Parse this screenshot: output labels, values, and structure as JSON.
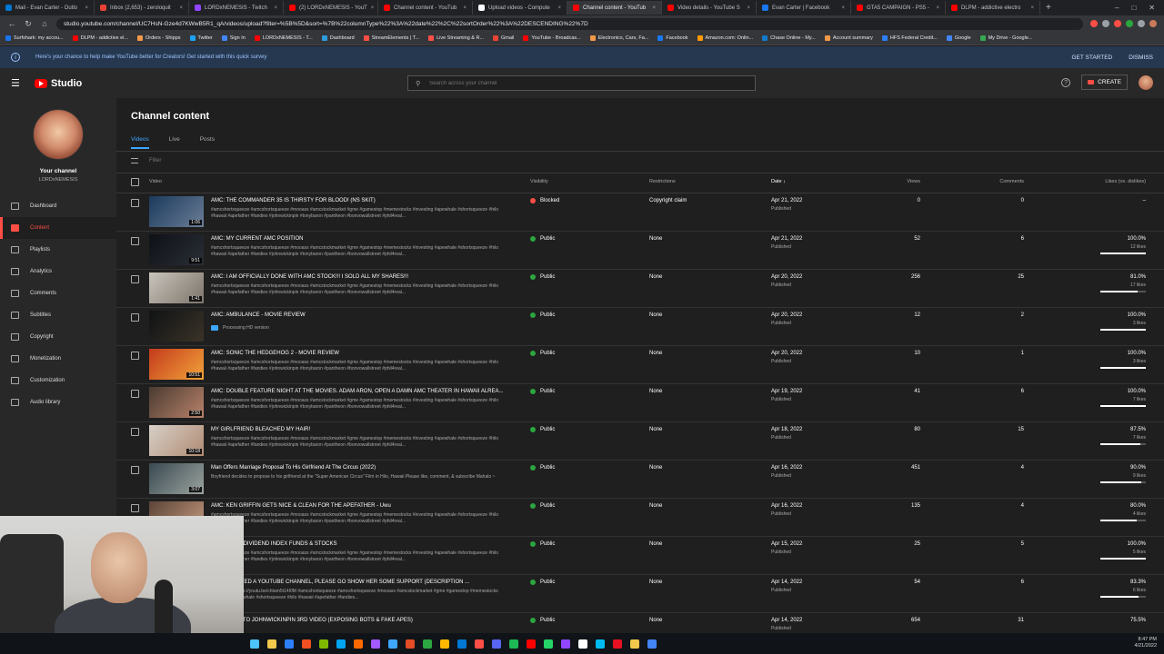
{
  "browser": {
    "tabs": [
      {
        "title": "Mail - Evan Carter - Outlo",
        "color": "#0078d4",
        "active": false
      },
      {
        "title": "Inbox (2,653) - zeroloquit",
        "color": "#ea4335",
        "active": false
      },
      {
        "title": "LORDxNEMESIS - Twitch",
        "color": "#9146ff",
        "active": false
      },
      {
        "title": "(2) LORDxNEMESIS - YouT",
        "color": "#ff0000",
        "active": false
      },
      {
        "title": "Channel content - YouTub",
        "color": "#ff0000",
        "active": false
      },
      {
        "title": "Upload videos - Compute",
        "color": "#ffffff",
        "active": false
      },
      {
        "title": "Channel content - YouTub",
        "color": "#ff0000",
        "active": true
      },
      {
        "title": "Video details - YouTube S",
        "color": "#ff0000",
        "active": false
      },
      {
        "title": "Evan Carter | Facebook",
        "color": "#1877f2",
        "active": false
      },
      {
        "title": "GTA5 CAMPAIGN - PS5 -",
        "color": "#ff0000",
        "active": false
      },
      {
        "title": "DLPM - addictive electro",
        "color": "#ff0000",
        "active": false
      }
    ],
    "new_tab": "+",
    "url": "studio.youtube.com/channel/UC7HsN-Gze4d7KWwB5R1_qA/videos/upload?filter=%5B%5D&sort=%7B%22columnType%22%3A%22date%22%2C%22sortOrder%22%3A%22DESCENDING%22%7D",
    "bookmarks": [
      "Surfshark: my accou...",
      "DLPM - addictive el...",
      "Orders - Shipps",
      "Twitter",
      "Sign In",
      "LORDxNEMESIS - T...",
      "Dashboard",
      "StreamElements | T...",
      "Live Streaming & R...",
      "Gmail",
      "YouTube - Broadcas...",
      "Electronics, Cars, Fa...",
      "Facebook",
      "Amazon.com: Onlin...",
      "Chase Online - My...",
      "Account summary",
      "HFS Federal Credit...",
      "Google",
      "My Drive - Google..."
    ]
  },
  "banner": {
    "text": "Here's your chance to help make YouTube better for Creators! Get started with this quick survey",
    "get_started": "GET STARTED",
    "dismiss": "DISMISS"
  },
  "header": {
    "studio": "Studio",
    "search_placeholder": "Search across your channel",
    "create": "CREATE"
  },
  "sidebar": {
    "your_channel": "Your channel",
    "channel_name": "LORDxNEMESIS",
    "items": [
      {
        "label": "Dashboard",
        "icon": "dashboard-icon",
        "active": false
      },
      {
        "label": "Content",
        "icon": "content-icon",
        "active": true
      },
      {
        "label": "Playlists",
        "icon": "playlists-icon",
        "active": false
      },
      {
        "label": "Analytics",
        "icon": "analytics-icon",
        "active": false
      },
      {
        "label": "Comments",
        "icon": "comments-icon",
        "active": false
      },
      {
        "label": "Subtitles",
        "icon": "subtitles-icon",
        "active": false
      },
      {
        "label": "Copyright",
        "icon": "copyright-icon",
        "active": false
      },
      {
        "label": "Monetization",
        "icon": "monetization-icon",
        "active": false
      },
      {
        "label": "Customization",
        "icon": "customization-icon",
        "active": false
      },
      {
        "label": "Audio library",
        "icon": "audio-library-icon",
        "active": false
      }
    ]
  },
  "main": {
    "title": "Channel content",
    "tabs": [
      "Videos",
      "Live",
      "Posts"
    ],
    "filter": "Filter",
    "columns": {
      "video": "Video",
      "visibility": "Visibility",
      "restrictions": "Restrictions",
      "date": "Date",
      "views": "Views",
      "comments": "Comments",
      "likes": "Likes (vs. dislikes)"
    },
    "rows": [
      {
        "title": "AMC: THE COMMANDER 35 IS THIRSTY FOR BLOOD! (NS SKIT)",
        "desc": "#amcshortsqueeze #amcshortsqueeze #mooass #amcstockmarket #gme #gamestop #memestocks #investing #apewhale #shortsqueeze #hilo #hawaii #apefather #fandies #johnwickinpin #tonybaron #pantheon #bonvowallstreet #phil4real...",
        "duration": "1:06",
        "thumb": [
          "#1b3a5c",
          "#6a7d96"
        ],
        "visibility": "Blocked",
        "vis_color": "#ff4e45",
        "restriction": "Copyright claim",
        "date": "Apr 21, 2022",
        "date_sub": "Published",
        "views": "0",
        "comments": "0",
        "likes": "–",
        "likes_sub": "",
        "likes_pct": 0
      },
      {
        "title": "AMC: MY CURRENT AMC POSITION",
        "desc": "#amcshortsqueeze #amcshortsqueeze #mooass #amcstockmarket #gme #gamestop #memestocks #investing #apewhale #shortsqueeze #hilo #hawaii #apefather #fandies #johnwickinpin #tonybaron #pantheon #bonvowallstreet #phil4real...",
        "duration": "9:51",
        "thumb": [
          "#0e1116",
          "#2a2e36"
        ],
        "visibility": "Public",
        "vis_color": "#2ba640",
        "restriction": "None",
        "date": "Apr 21, 2022",
        "date_sub": "Published",
        "views": "52",
        "comments": "6",
        "likes": "100.0%",
        "likes_sub": "12 likes",
        "likes_pct": 100
      },
      {
        "title": "AMC: I AM OFFICIALLY DONE WITH AMC STOCK!!! I SOLD ALL MY SHARES!!!",
        "desc": "#amcshortsqueeze #amcshortsqueeze #mooass #amcstockmarket #gme #gamestop #memestocks #investing #apewhale #shortsqueeze #hilo #hawaii #apefather #fandies #johnwickinpin #tonybaron #pantheon #bonvowallstreet #phil4real...",
        "duration": "1:41",
        "thumb": [
          "#c9c4bc",
          "#7c746a"
        ],
        "visibility": "Public",
        "vis_color": "#2ba640",
        "restriction": "None",
        "date": "Apr 20, 2022",
        "date_sub": "Published",
        "views": "256",
        "comments": "25",
        "likes": "81.0%",
        "likes_sub": "17 likes",
        "likes_pct": 81
      },
      {
        "title": "AMC: AMBULANCE - MOVIE REVIEW",
        "desc": "",
        "processing": "Processing HD version",
        "duration": "",
        "thumb": [
          "#101214",
          "#3a3328"
        ],
        "visibility": "Public",
        "vis_color": "#2ba640",
        "restriction": "None",
        "date": "Apr 20, 2022",
        "date_sub": "Published",
        "views": "12",
        "comments": "2",
        "likes": "100.0%",
        "likes_sub": "3 likes",
        "likes_pct": 100
      },
      {
        "title": "AMC: SONIC THE HEDGEHOG 2 - MOVIE REVIEW",
        "desc": "#amcshortsqueeze #amcshortsqueeze #mooass #amcstockmarket #gme #gamestop #memestocks #investing #apewhale #shortsqueeze #hilo #hawaii #apefather #fandies #johnwickinpin #tonybaron #pantheon #bonvowallstreet #phil4real...",
        "duration": "10:51",
        "thumb": [
          "#c43b1c",
          "#f2a33a"
        ],
        "visibility": "Public",
        "vis_color": "#2ba640",
        "restriction": "None",
        "date": "Apr 20, 2022",
        "date_sub": "Published",
        "views": "10",
        "comments": "1",
        "likes": "100.0%",
        "likes_sub": "3 likes",
        "likes_pct": 100
      },
      {
        "title": "AMC: DOUBLE FEATURE NIGHT AT THE MOVIES. ADAM ARON, OPEN A DAMN AMC THEATER IN HAWAII ALREA...",
        "desc": "#amcshortsqueeze #amcshortsqueeze #mooass #amcstockmarket #gme #gamestop #memestocks #investing #apewhale #shortsqueeze #hilo #hawaii #apefather #fandies #johnwickinpin #tonybaron #pantheon #bonvowallstreet #phil4real...",
        "duration": "2:50",
        "thumb": [
          "#4a3b31",
          "#b8826a"
        ],
        "visibility": "Public",
        "vis_color": "#2ba640",
        "restriction": "None",
        "date": "Apr 19, 2022",
        "date_sub": "Published",
        "views": "41",
        "comments": "6",
        "likes": "100.0%",
        "likes_sub": "7 likes",
        "likes_pct": 100
      },
      {
        "title": "MY GIRLFRIEND BLEACHED MY HAIR!",
        "desc": "#amcshortsqueeze #amcshortsqueeze #mooass #amcstockmarket #gme #gamestop #memestocks #investing #apewhale #shortsqueeze #hilo #hawaii #apefather #fandies #johnwickinpin #tonybaron #pantheon #bonvowallstreet #phil4real...",
        "duration": "10:18",
        "thumb": [
          "#d7d0c8",
          "#b08a72"
        ],
        "visibility": "Public",
        "vis_color": "#2ba640",
        "restriction": "None",
        "date": "Apr 18, 2022",
        "date_sub": "Published",
        "views": "80",
        "comments": "15",
        "likes": "87.5%",
        "likes_sub": "7 likes",
        "likes_pct": 87.5
      },
      {
        "title": "Man Offers Marriage Proposal To His Girlfriend At The Circus (2022)",
        "desc": "Boyfriend decides to propose to his girlfriend at the \"Super American Circus\" Film in Hilo, Hawaii Please like, comment, & subscribe Mahalo ~",
        "duration": "3:07",
        "thumb": [
          "#3b4a52",
          "#9aa39e"
        ],
        "visibility": "Public",
        "vis_color": "#2ba640",
        "restriction": "None",
        "date": "Apr 16, 2022",
        "date_sub": "Published",
        "views": "451",
        "comments": "4",
        "likes": "90.0%",
        "likes_sub": "9 likes",
        "likes_pct": 90
      },
      {
        "title": "AMC: KEN GRIFFIN GETS NICE & CLEAN FOR THE APEFATHER - Uwu",
        "desc": "#amcshortsqueeze #amcshortsqueeze #mooass #amcstockmarket #gme #gamestop #memestocks #investing #apewhale #shortsqueeze #hilo #hawaii #apefather #fandies #johnwickinpin #tonybaron #pantheon #bonvowallstreet #phil4real...",
        "duration": "",
        "thumb": [
          "#5a4438",
          "#c79a7e"
        ],
        "visibility": "Public",
        "vis_color": "#2ba640",
        "restriction": "None",
        "date": "Apr 16, 2022",
        "date_sub": "Published",
        "views": "135",
        "comments": "4",
        "likes": "80.0%",
        "likes_sub": "4 likes",
        "likes_pct": 80
      },
      {
        "title": "HIGH YIELD DIVIDEND INDEX FUNDS & STOCKS",
        "desc": "#amcshortsqueeze #amcshortsqueeze #mooass #amcstockmarket #gme #gamestop #memestocks #investing #apewhale #shortsqueeze #hilo #hawaii #apefather #fandies #johnwickinpin #tonybaron #pantheon #bonvowallstreet #phil4real...",
        "duration": "",
        "thumb": [
          "#222",
          "#555"
        ],
        "visibility": "Public",
        "vis_color": "#2ba640",
        "restriction": "None",
        "date": "Apr 15, 2022",
        "date_sub": "Published",
        "views": "25",
        "comments": "5",
        "likes": "100.0%",
        "likes_sub": "5 likes",
        "likes_pct": 100
      },
      {
        "title": "JUST CREATED A YOUTUBE CHANNEL, PLEASE GO SHOW HER SOME SUPPORT (DESCRIPTION ...",
        "desc": "CHANNEL: https://youtu.be/chtam5t14I0M #amcshortsqueeze #amcshortsqueeze #mooass #amcstockmarket #gme #gamestop #memestocks #investing #apewhale #shortsqueeze #hilo #hawaii #apefather #fandies...",
        "duration": "",
        "thumb": [
          "#222",
          "#555"
        ],
        "visibility": "Public",
        "vis_color": "#2ba640",
        "restriction": "None",
        "date": "Apr 14, 2022",
        "date_sub": "Published",
        "views": "54",
        "comments": "6",
        "likes": "83.3%",
        "likes_sub": "6 likes",
        "likes_pct": 83.3
      },
      {
        "title": "RESPONSE TO JOHNWICKINPIN 3RD VIDEO (EXPOSING BOTS & FAKE APES)",
        "desc": "",
        "duration": "",
        "thumb": [
          "#222",
          "#555"
        ],
        "visibility": "Public",
        "vis_color": "#2ba640",
        "restriction": "None",
        "date": "Apr 14, 2022",
        "date_sub": "Published",
        "views": "654",
        "comments": "31",
        "likes": "75.5%",
        "likes_sub": "",
        "likes_pct": 75.5
      }
    ]
  },
  "taskbar": {
    "time": "8:47 PM",
    "date": "4/21/2022",
    "icons": [
      "#4cc2ff",
      "#f2c94c",
      "#2d7ff9",
      "#f25022",
      "#7fba00",
      "#00a4ef",
      "#ff6a00",
      "#a259ff",
      "#3ea6ff",
      "#e44d26",
      "#2ba640",
      "#ffb900",
      "#0078d4",
      "#ff4e45",
      "#5865f2",
      "#1db954",
      "#ff0000",
      "#25d366",
      "#9146ff",
      "#ffffff",
      "#00bcf2",
      "#e81123",
      "#f2c94c",
      "#4285f4"
    ]
  }
}
